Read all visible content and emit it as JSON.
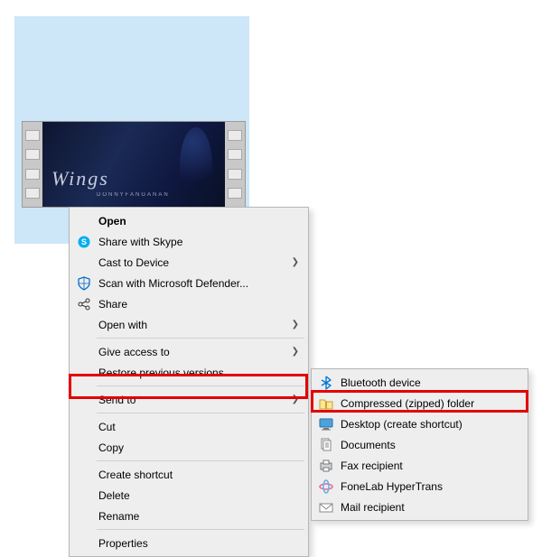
{
  "video": {
    "overlay_title": "Wings",
    "overlay_subtitle": "DONNYFANGANAN"
  },
  "menu1": {
    "open": "Open",
    "share_skype": "Share with Skype",
    "cast": "Cast to Device",
    "defender": "Scan with Microsoft Defender...",
    "share": "Share",
    "open_with": "Open with",
    "give_access": "Give access to",
    "restore": "Restore previous versions",
    "send_to": "Send to",
    "cut": "Cut",
    "copy": "Copy",
    "shortcut": "Create shortcut",
    "delete": "Delete",
    "rename": "Rename",
    "properties": "Properties"
  },
  "menu2": {
    "bluetooth": "Bluetooth device",
    "zip": "Compressed (zipped) folder",
    "desktop": "Desktop (create shortcut)",
    "documents": "Documents",
    "fax": "Fax recipient",
    "hypertrans": "FoneLab HyperTrans",
    "mail": "Mail recipient"
  }
}
